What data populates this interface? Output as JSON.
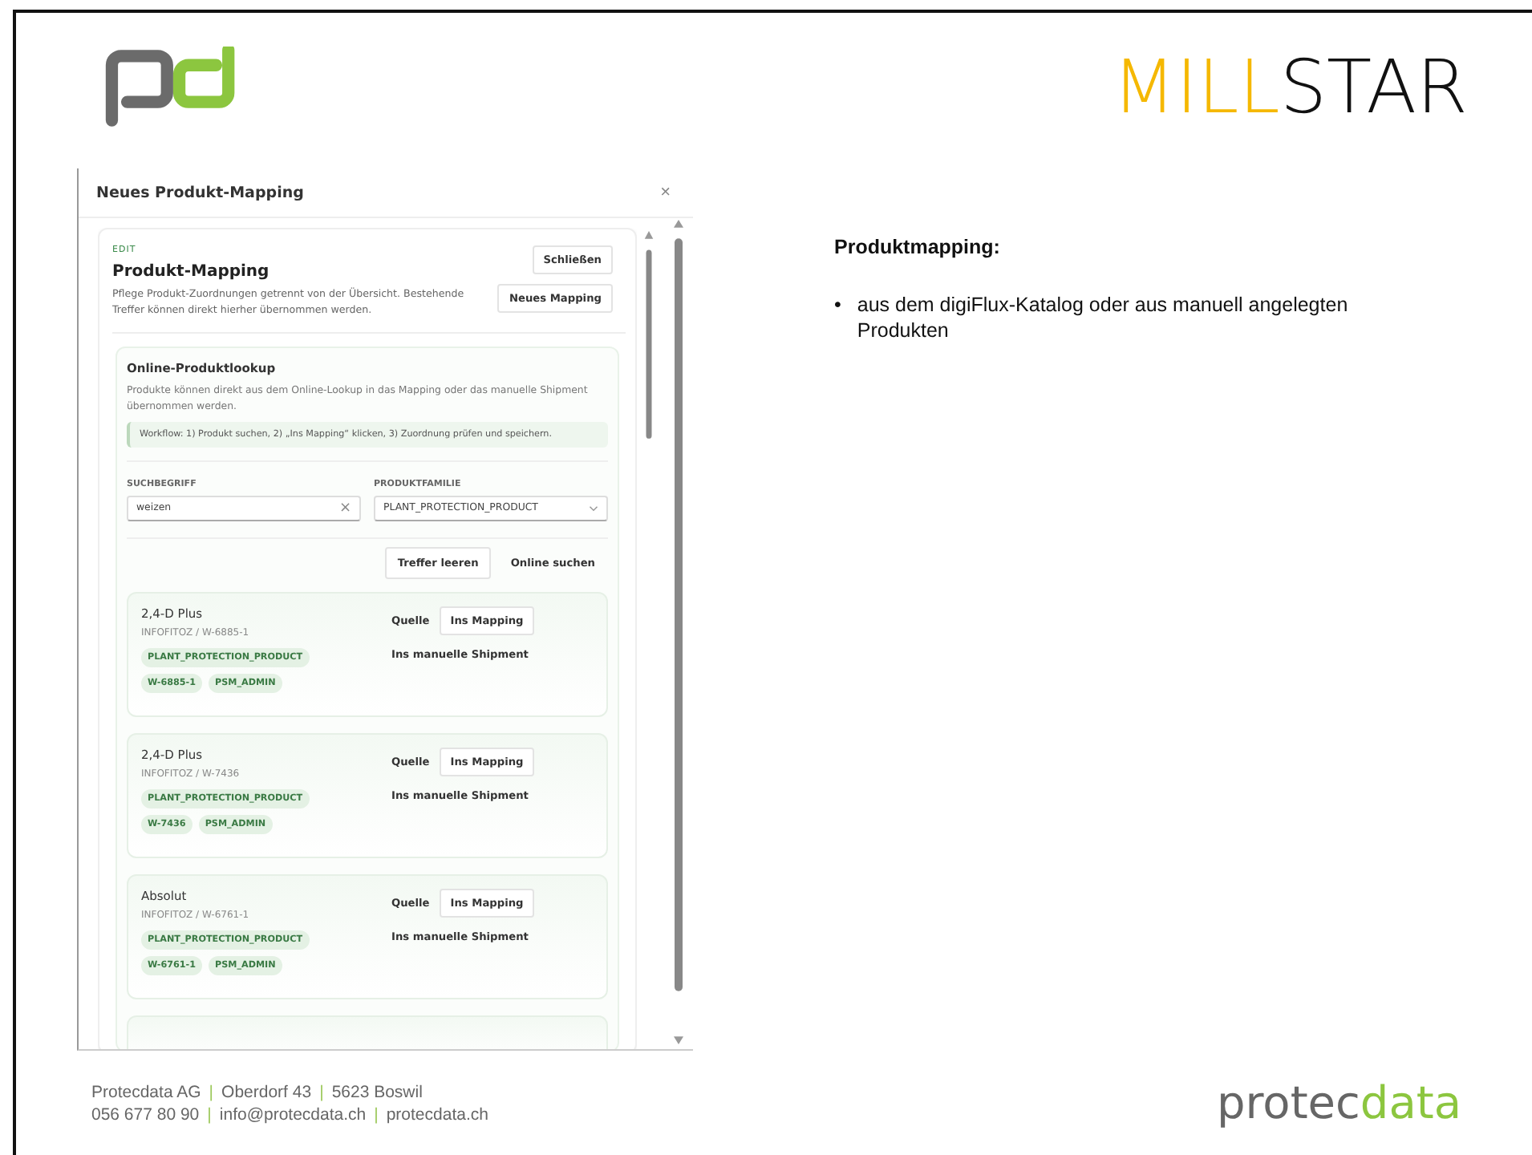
{
  "brand": {
    "parts": [
      "MILL",
      "STAR"
    ]
  },
  "dialog": {
    "title": "Neues Produkt-Mapping",
    "close": "×",
    "card": {
      "eyebrow": "EDIT",
      "title": "Produkt-Mapping",
      "description": "Pflege Produkt-Zuordnungen getrennt von der Übersicht. Bestehende Treffer können direkt hierher übernommen werden.",
      "buttons": [
        "Schließen",
        "Neues Mapping"
      ]
    },
    "lookup": {
      "title": "Online-Produktlookup",
      "description": "Produkte können direkt aus dem Online-Lookup in das Mapping oder das manuelle Shipment übernommen werden.",
      "note": "Workflow: 1) Produkt suchen, 2) „Ins Mapping“ klicken, 3) Zuordnung prüfen und speichern.",
      "search": {
        "label": "SUCHBEGRIFF",
        "value": "weizen",
        "clear": "×"
      },
      "family": {
        "label": "PRODUKTFAMILIE",
        "value": "PLANT_PROTECTION_PRODUCT"
      },
      "actions": [
        {
          "label": "Treffer leeren",
          "kind": "outlined"
        },
        {
          "label": "Online suchen",
          "kind": "plain"
        }
      ]
    },
    "results": [
      {
        "name": "2,4-D Plus",
        "source": "INFOFITOZ / W-6885-1",
        "tags": [
          [
            "PLANT_PROTECTION_PRODUCT"
          ],
          [
            "W-6885-1",
            "PSM_ADMIN"
          ]
        ],
        "quelle": "Quelle",
        "map_button": "Ins Mapping",
        "shipment": "Ins manuelle Shipment"
      },
      {
        "name": "2,4-D Plus",
        "source": "INFOFITOZ / W-7436",
        "tags": [
          [
            "PLANT_PROTECTION_PRODUCT"
          ],
          [
            "W-7436",
            "PSM_ADMIN"
          ]
        ],
        "quelle": "Quelle",
        "map_button": "Ins Mapping",
        "shipment": "Ins manuelle Shipment"
      },
      {
        "name": "Absolut",
        "source": "INFOFITOZ / W-6761-1",
        "tags": [
          [
            "PLANT_PROTECTION_PRODUCT"
          ],
          [
            "W-6761-1",
            "PSM_ADMIN"
          ]
        ],
        "quelle": "Quelle",
        "map_button": "Ins Mapping",
        "shipment": "Ins manuelle Shipment"
      }
    ]
  },
  "notes": {
    "heading": "Produktmapping:",
    "bullet": "•",
    "items": [
      "aus dem digiFlux-Katalog oder aus manuell angelegten Produkten"
    ]
  },
  "footer": {
    "separator": "|",
    "lines": [
      [
        "Protecdata AG",
        "Oberdorf 43",
        "5623 Boswil"
      ],
      [
        "056 677 80 90",
        "info@protecdata.ch",
        "protecdata.ch"
      ]
    ],
    "logo": [
      "protec",
      "data"
    ]
  }
}
